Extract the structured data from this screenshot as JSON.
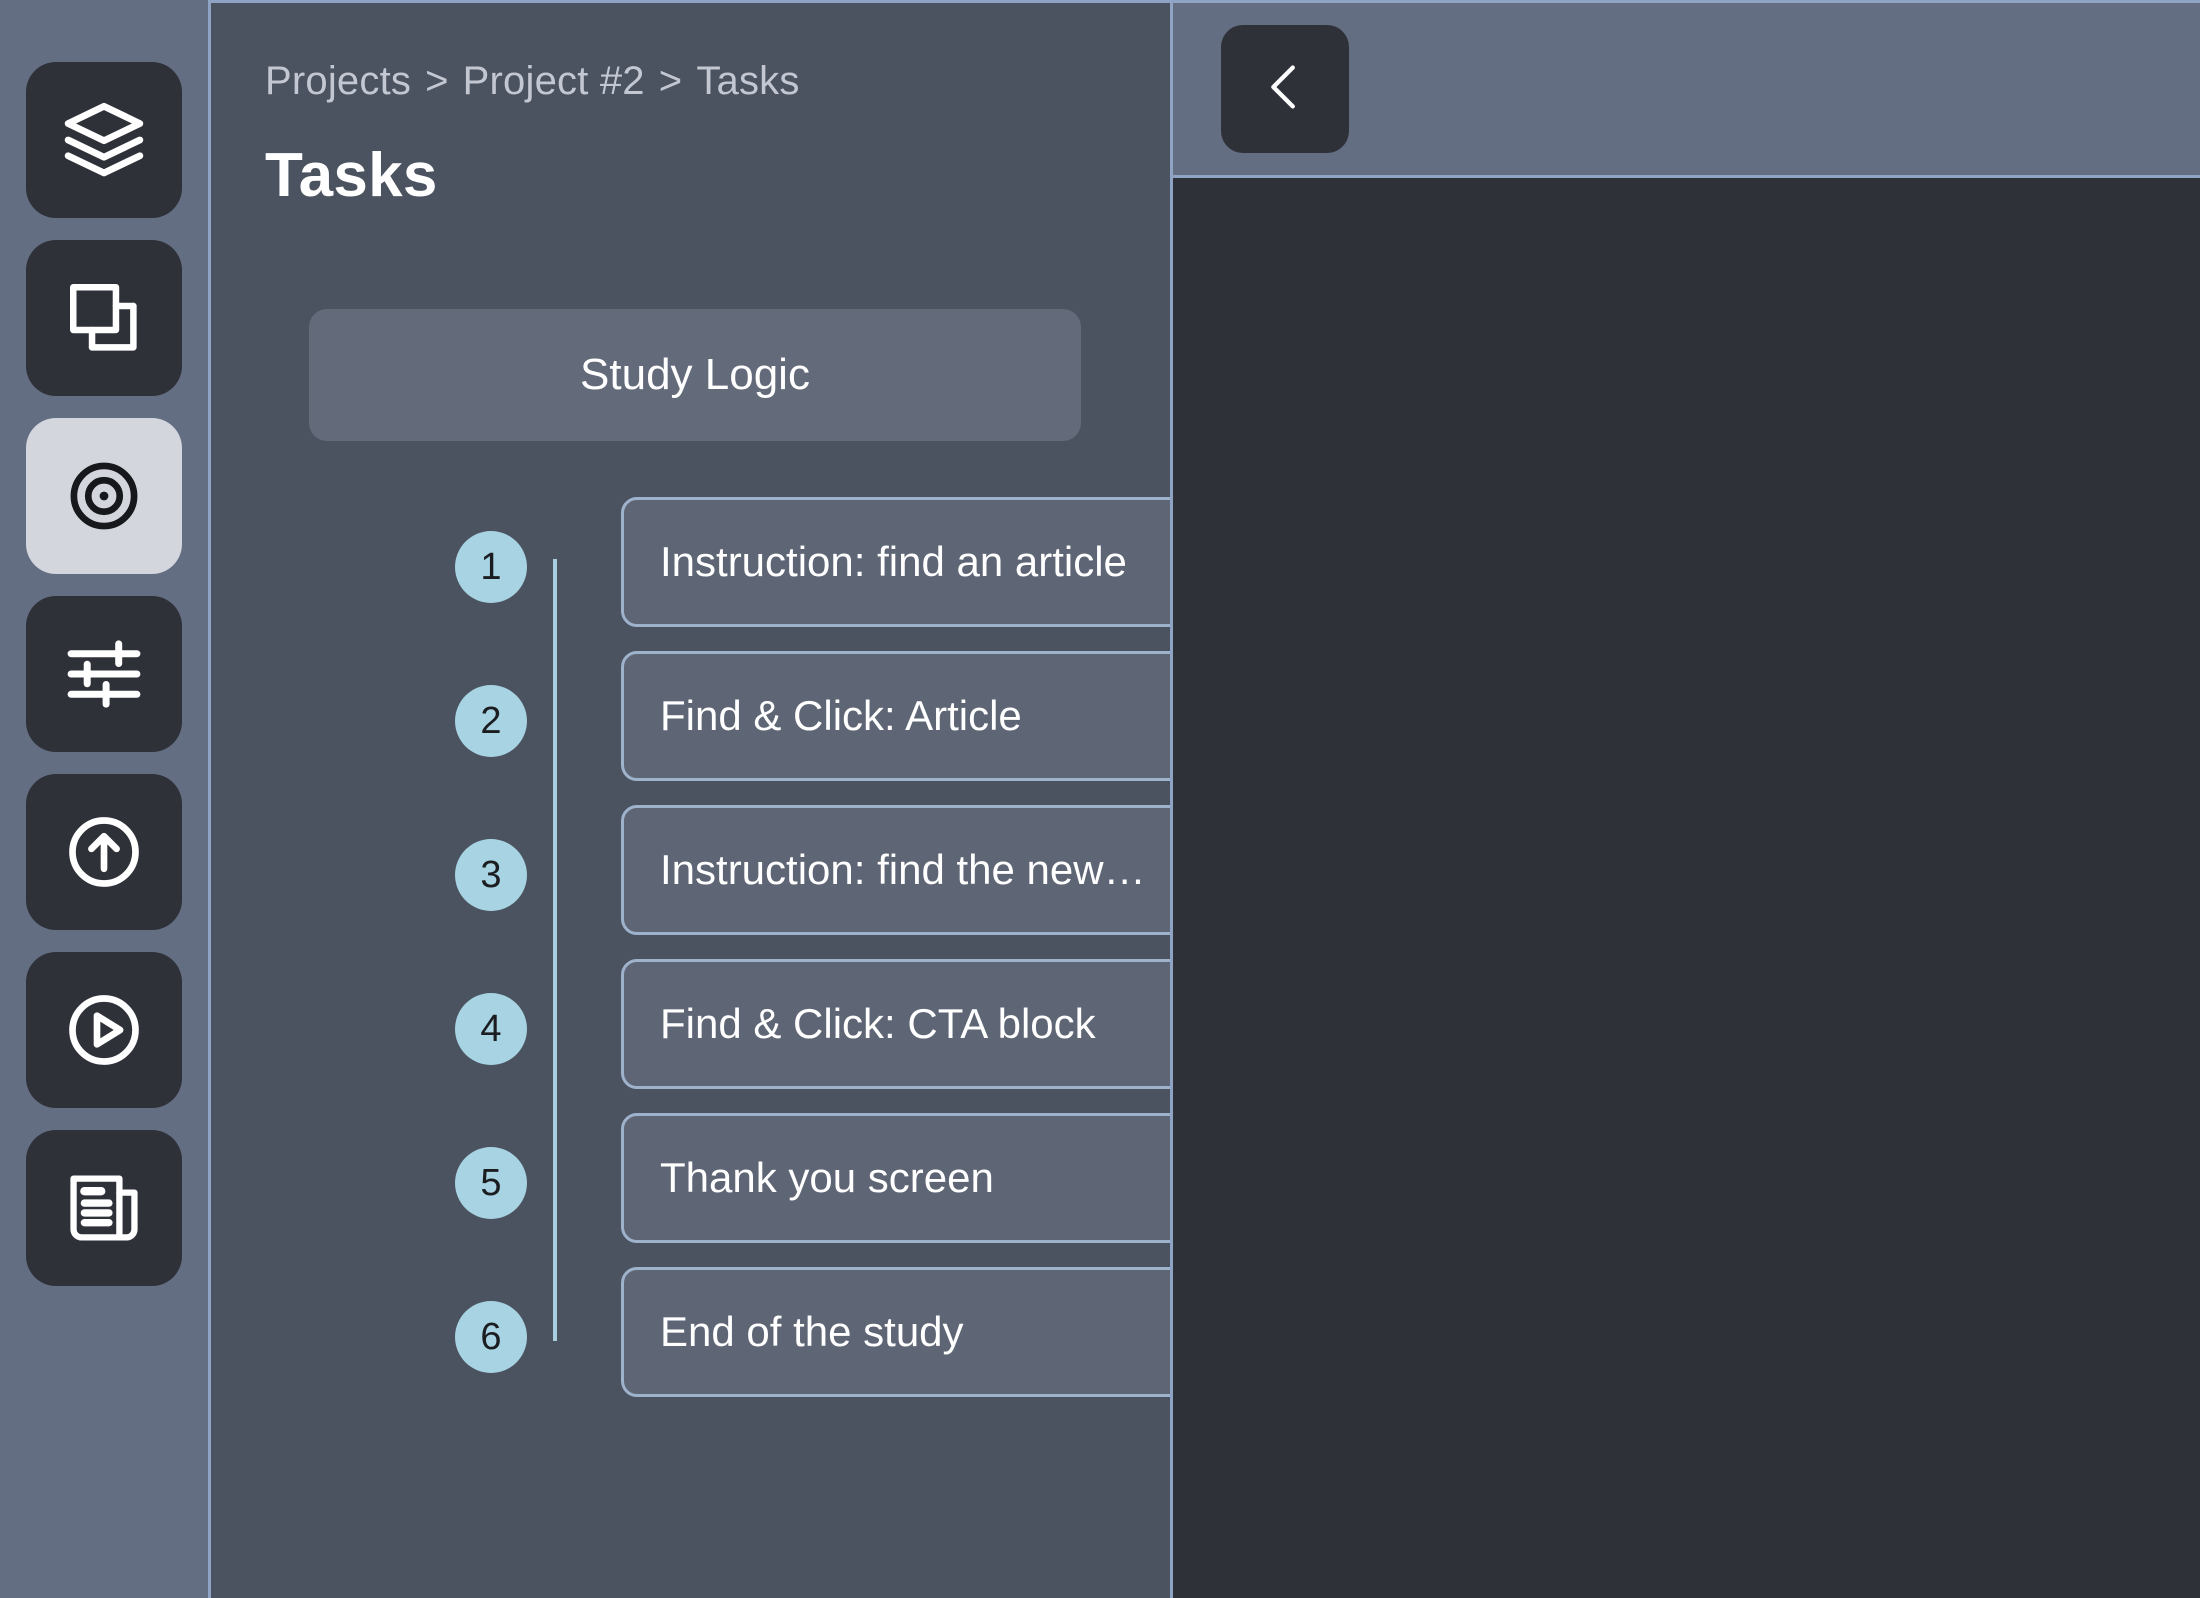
{
  "sidebar": {
    "items": [
      {
        "icon": "layers-icon",
        "name": "sidebar-item-layers",
        "active": false
      },
      {
        "icon": "copy-pages-icon",
        "name": "sidebar-item-pages",
        "active": false
      },
      {
        "icon": "target-icon",
        "name": "sidebar-item-tasks",
        "active": true
      },
      {
        "icon": "sliders-icon",
        "name": "sidebar-item-settings",
        "active": false
      },
      {
        "icon": "arrow-up-circle-icon",
        "name": "sidebar-item-publish",
        "active": false
      },
      {
        "icon": "play-circle-icon",
        "name": "sidebar-item-preview",
        "active": false
      },
      {
        "icon": "article-icon",
        "name": "sidebar-item-report",
        "active": false
      }
    ]
  },
  "breadcrumb": {
    "items": [
      "Projects",
      "Project #2",
      "Tasks"
    ],
    "separator": ">"
  },
  "page": {
    "title": "Tasks"
  },
  "study_logic": {
    "label": "Study Logic"
  },
  "tasks": [
    {
      "number": "1",
      "label": "Instruction: find an article"
    },
    {
      "number": "2",
      "label": "Find & Click: Article"
    },
    {
      "number": "3",
      "label": "Instruction: find the new…"
    },
    {
      "number": "4",
      "label": "Find & Click: CTA block"
    },
    {
      "number": "5",
      "label": "Thank you screen"
    },
    {
      "number": "6",
      "label": "End of the study"
    }
  ],
  "right_panel": {
    "back_button": {
      "icon": "chevron-left-icon",
      "label": ""
    }
  },
  "colors": {
    "rail_bg": "#646e82",
    "panel_bg": "#4b5260",
    "card_bg": "#5e6574",
    "card_border": "#9fb2cc",
    "accent_bullet": "#a7d3e2",
    "icon_tile": "#2e3138",
    "icon_tile_active": "#d3d6dd",
    "panel_border": "#8fa4c4",
    "canvas_bg": "#2e3138",
    "text_primary": "#ffffff",
    "text_muted": "#c2c7d1"
  }
}
